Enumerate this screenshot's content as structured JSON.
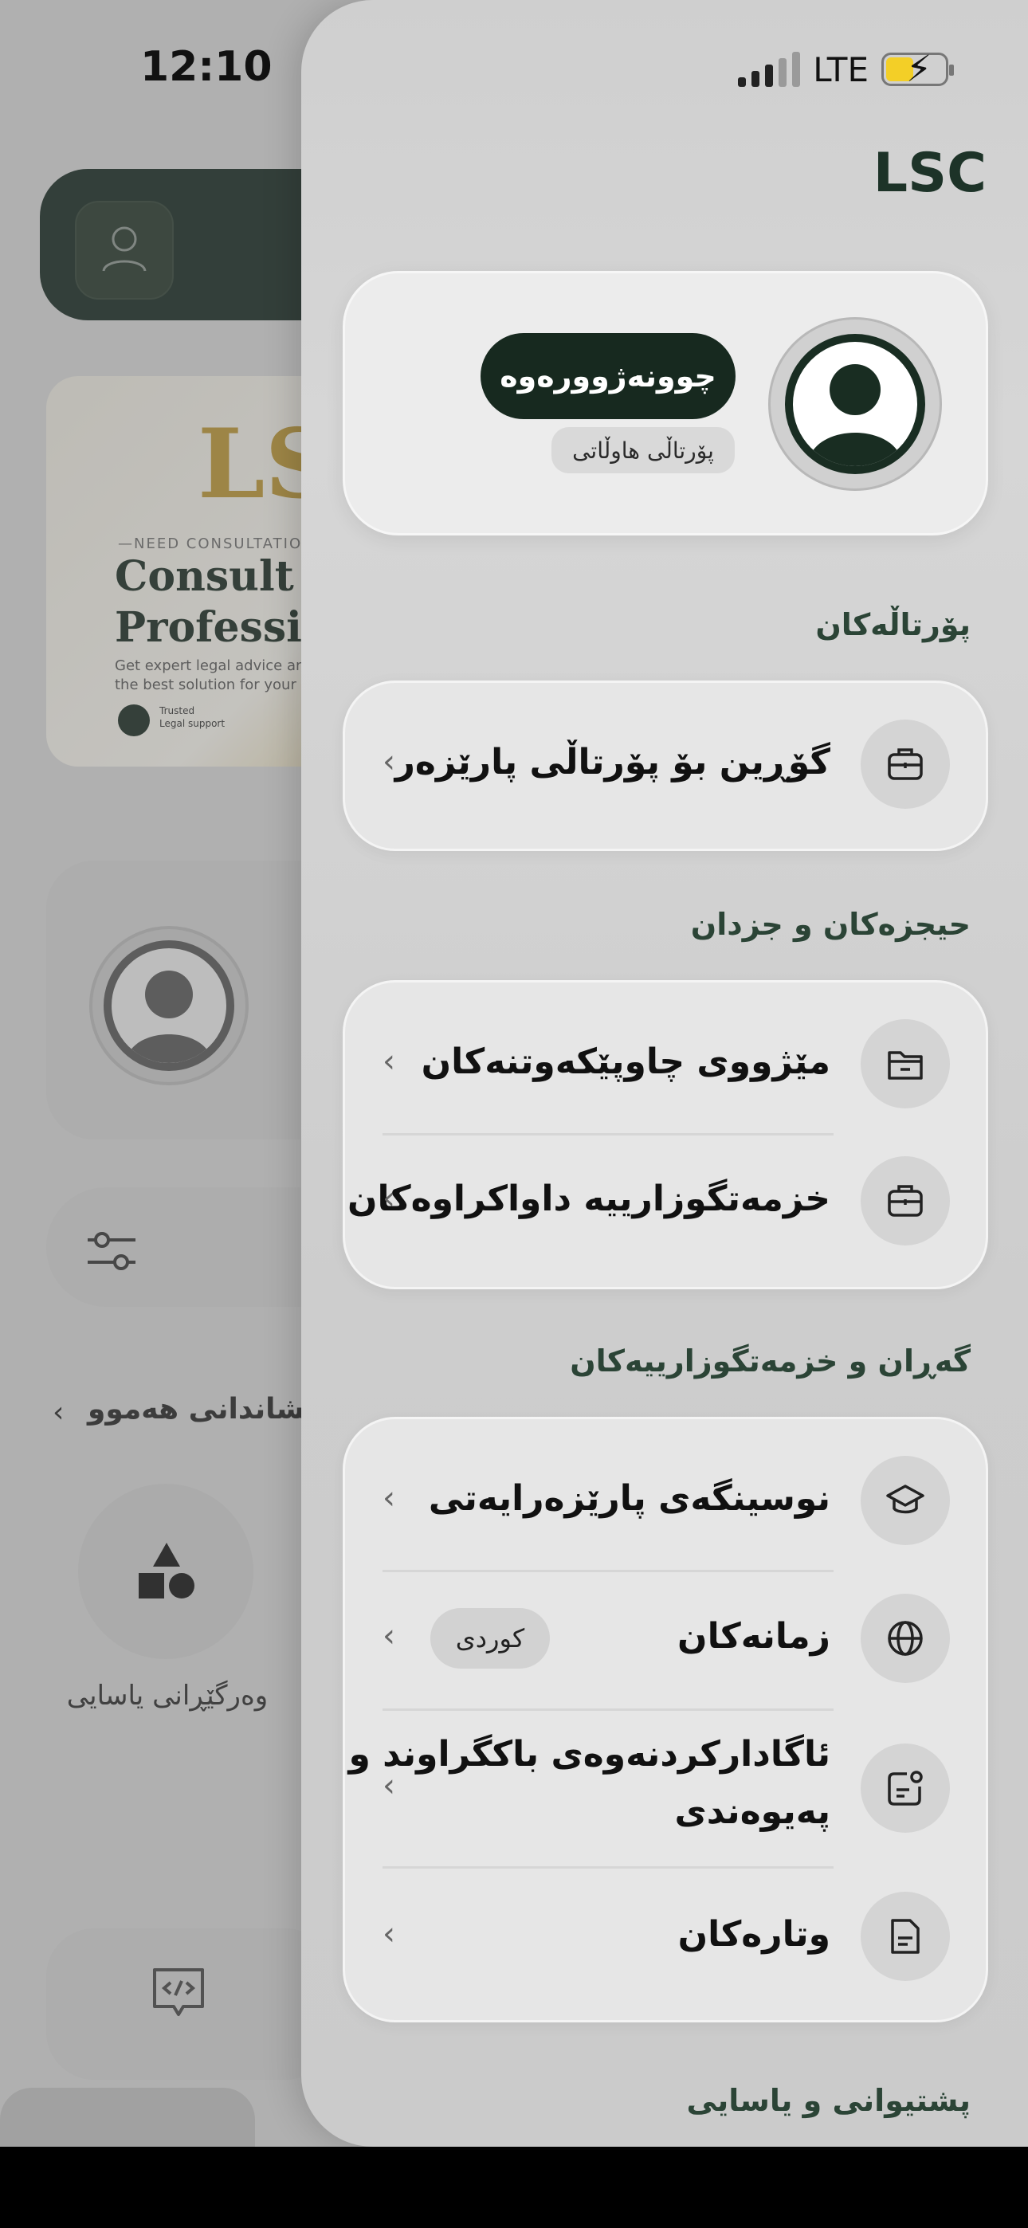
{
  "status_bar": {
    "time": "12:10",
    "network": "LTE"
  },
  "background": {
    "banner": {
      "logo_text": "LS",
      "eyebrow": "—NEED CONSULTATION",
      "headline_line1": "Consult O",
      "headline_line2": "Professiona",
      "subtext_line1": "Get expert legal advice an",
      "subtext_line2": "the best solution for your c",
      "badge1_line1": "Trusted",
      "badge1_line2": "Legal support"
    },
    "see_all": "یشاندانی هەموو",
    "service_label": "وەرگێڕانی یاسایی"
  },
  "drawer": {
    "brand": "LSC",
    "profile": {
      "login_button": "چوونەژوورەوە",
      "portal_chip": "پۆرتاڵی هاوڵاتی"
    },
    "sections": [
      {
        "title": "پۆرتاڵەکان",
        "items": [
          {
            "label": "گۆڕین بۆ پۆرتاڵی پارێزەر",
            "icon": "briefcase-icon"
          }
        ]
      },
      {
        "title": "حیجزەکان و جزدان",
        "items": [
          {
            "label": "مێژووی چاوپێکەوتنەکان",
            "icon": "folder-icon"
          },
          {
            "label": "خزمەتگوزارییە داواکراوەکان",
            "icon": "briefcase-icon"
          }
        ]
      },
      {
        "title": "گەڕان و خزمەتگوزارییەکان",
        "items": [
          {
            "label": "نوسینگەی پارێزەرایەتی",
            "icon": "graduation-cap-icon"
          },
          {
            "label": "زمانەکان",
            "icon": "globe-icon",
            "value": "كوردی"
          },
          {
            "label_line1": "ئاگادارکردنەوەی باکگراوند و",
            "label_line2": "پەیوەندی",
            "icon": "notification-icon"
          },
          {
            "label": "وتارەکان",
            "icon": "document-icon"
          }
        ]
      },
      {
        "title": "پشتیوانی و یاسایی"
      }
    ]
  },
  "colors": {
    "brand_dark": "#17291f",
    "section_title": "#2b4436",
    "battery": "#f3cf27"
  }
}
